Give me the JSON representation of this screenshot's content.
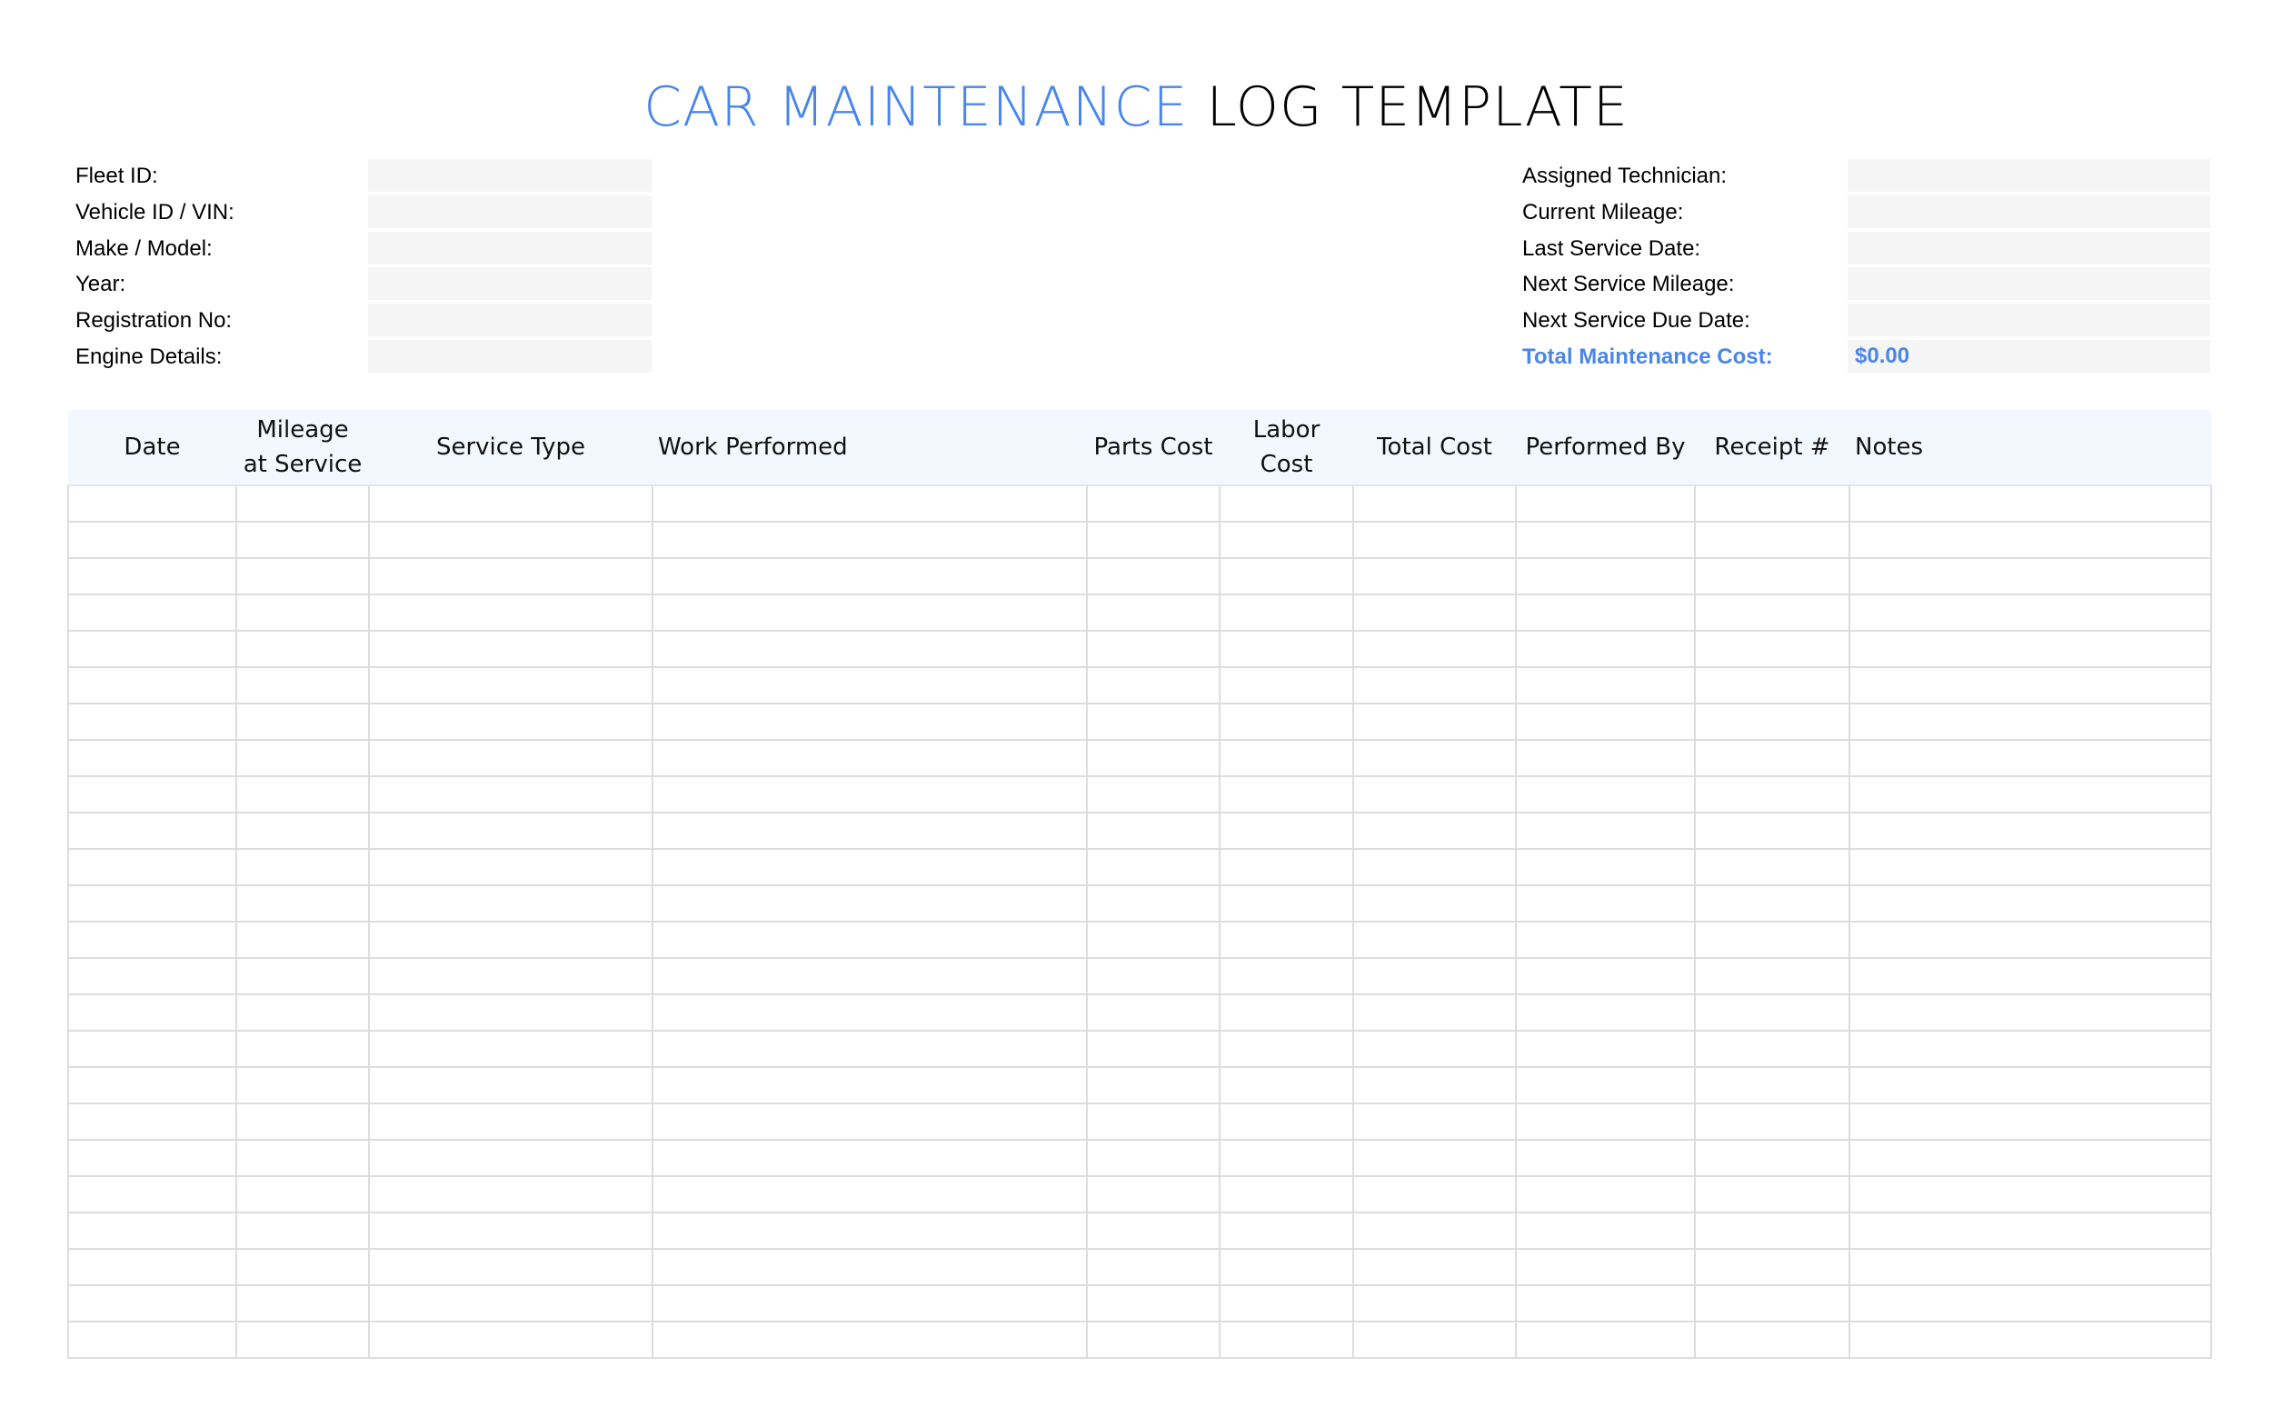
{
  "title": {
    "accent": "CAR MAINTENANCE",
    "rest": "LOG TEMPLATE"
  },
  "vehicle_info": [
    {
      "label": "Fleet ID:",
      "value": ""
    },
    {
      "label": "Vehicle ID / VIN:",
      "value": ""
    },
    {
      "label": "Make / Model:",
      "value": ""
    },
    {
      "label": "Year:",
      "value": ""
    },
    {
      "label": "Registration No:",
      "value": ""
    },
    {
      "label": "Engine Details:",
      "value": ""
    }
  ],
  "service_info": [
    {
      "label": "Assigned Technician:",
      "value": ""
    },
    {
      "label": "Current Mileage:",
      "value": ""
    },
    {
      "label": "Last Service Date:",
      "value": ""
    },
    {
      "label": "Next Service Mileage:",
      "value": ""
    },
    {
      "label": "Next Service Due Date:",
      "value": ""
    },
    {
      "label": "Total Maintenance Cost:",
      "value": "$0.00"
    }
  ],
  "table": {
    "columns": [
      "Date",
      "Mileage at Service",
      "Service Type",
      "Work Performed",
      "Parts Cost",
      "Labor Cost",
      "Total Cost",
      "Performed By",
      "Receipt #",
      "Notes"
    ],
    "row_count": 24
  },
  "colors": {
    "accent": "#4a86e8",
    "header_bg": "#f3f7fe",
    "field_bg": "#f5f5f5",
    "grid": "#dddddd"
  }
}
